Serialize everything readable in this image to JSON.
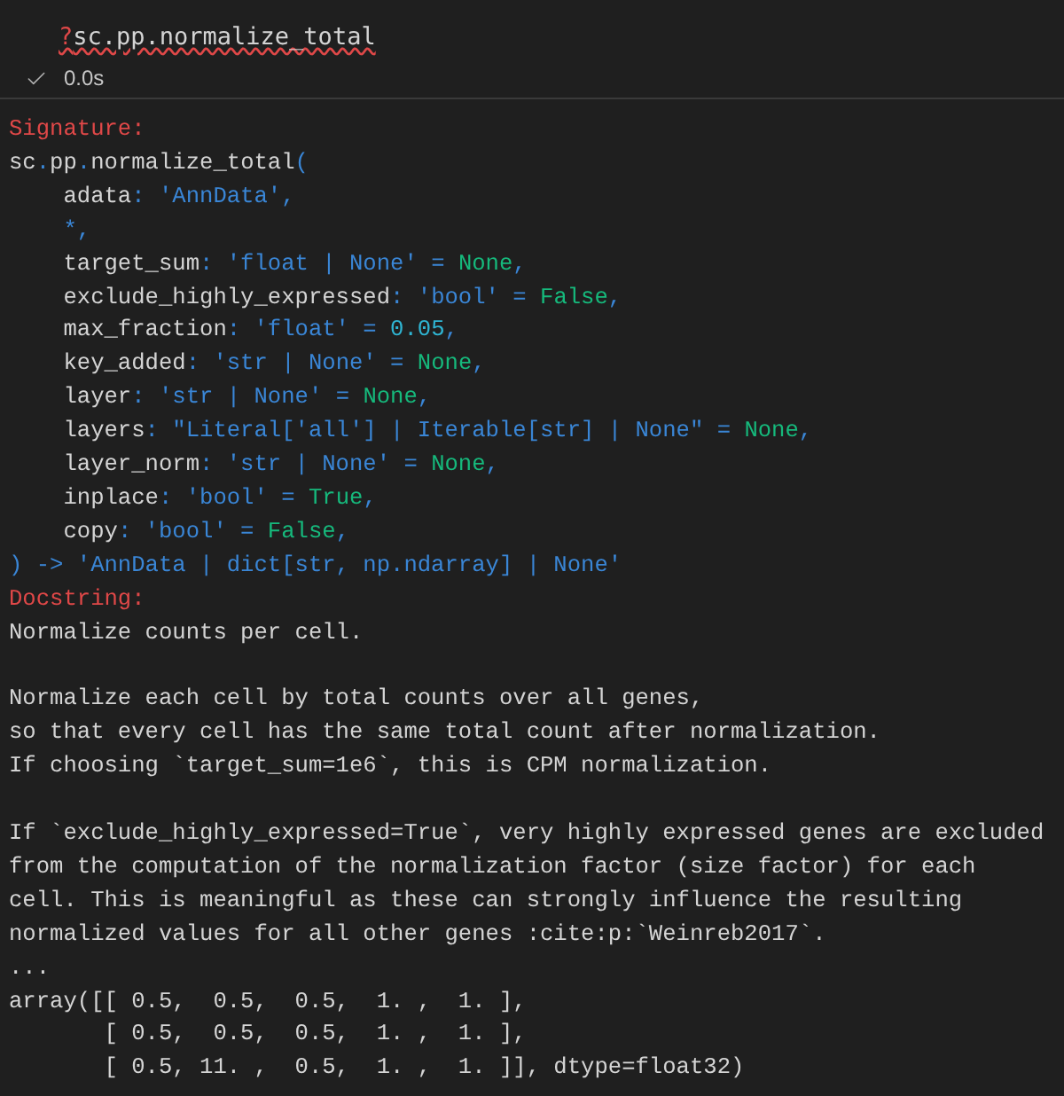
{
  "input_cell": {
    "prompt_char": "?",
    "code": "sc.pp.normalize_total",
    "has_error": true
  },
  "status": {
    "succeeded": true,
    "duration": "0.0s"
  },
  "output": [
    {
      "kind": "line",
      "tokens": [
        {
          "kind": "heading",
          "text": "Signature:"
        }
      ]
    },
    {
      "kind": "line",
      "tokens": [
        {
          "kind": "plain",
          "text": "sc"
        },
        {
          "kind": "type",
          "text": "."
        },
        {
          "kind": "plain",
          "text": "pp"
        },
        {
          "kind": "type",
          "text": "."
        },
        {
          "kind": "plain",
          "text": "normalize_total"
        },
        {
          "kind": "type",
          "text": "("
        }
      ]
    },
    {
      "kind": "line",
      "tokens": [
        {
          "kind": "plain",
          "text": "    adata"
        },
        {
          "kind": "type",
          "text": ": 'AnnData',"
        }
      ]
    },
    {
      "kind": "line",
      "tokens": [
        {
          "kind": "type",
          "text": "    *,"
        }
      ]
    },
    {
      "kind": "line",
      "tokens": [
        {
          "kind": "plain",
          "text": "    target_sum"
        },
        {
          "kind": "type",
          "text": ": 'float | None' = "
        },
        {
          "kind": "constant",
          "text": "None"
        },
        {
          "kind": "type",
          "text": ","
        }
      ]
    },
    {
      "kind": "line",
      "tokens": [
        {
          "kind": "plain",
          "text": "    exclude_highly_expressed"
        },
        {
          "kind": "type",
          "text": ": 'bool' = "
        },
        {
          "kind": "constant",
          "text": "False"
        },
        {
          "kind": "type",
          "text": ","
        }
      ]
    },
    {
      "kind": "line",
      "tokens": [
        {
          "kind": "plain",
          "text": "    max_fraction"
        },
        {
          "kind": "type",
          "text": ": 'float' = "
        },
        {
          "kind": "number",
          "text": "0.05"
        },
        {
          "kind": "type",
          "text": ","
        }
      ]
    },
    {
      "kind": "line",
      "tokens": [
        {
          "kind": "plain",
          "text": "    key_added"
        },
        {
          "kind": "type",
          "text": ": 'str | None' = "
        },
        {
          "kind": "constant",
          "text": "None"
        },
        {
          "kind": "type",
          "text": ","
        }
      ]
    },
    {
      "kind": "line",
      "tokens": [
        {
          "kind": "plain",
          "text": "    layer"
        },
        {
          "kind": "type",
          "text": ": 'str | None' = "
        },
        {
          "kind": "constant",
          "text": "None"
        },
        {
          "kind": "type",
          "text": ","
        }
      ]
    },
    {
      "kind": "line",
      "tokens": [
        {
          "kind": "plain",
          "text": "    layers"
        },
        {
          "kind": "type",
          "text": ": \"Literal['all'] | Iterable[str] | None\" = "
        },
        {
          "kind": "constant",
          "text": "None"
        },
        {
          "kind": "type",
          "text": ","
        }
      ]
    },
    {
      "kind": "line",
      "tokens": [
        {
          "kind": "plain",
          "text": "    layer_norm"
        },
        {
          "kind": "type",
          "text": ": 'str | None' = "
        },
        {
          "kind": "constant",
          "text": "None"
        },
        {
          "kind": "type",
          "text": ","
        }
      ]
    },
    {
      "kind": "line",
      "tokens": [
        {
          "kind": "plain",
          "text": "    inplace"
        },
        {
          "kind": "type",
          "text": ": 'bool' = "
        },
        {
          "kind": "constant",
          "text": "True"
        },
        {
          "kind": "type",
          "text": ","
        }
      ]
    },
    {
      "kind": "line",
      "tokens": [
        {
          "kind": "plain",
          "text": "    copy"
        },
        {
          "kind": "type",
          "text": ": 'bool' = "
        },
        {
          "kind": "constant",
          "text": "False"
        },
        {
          "kind": "type",
          "text": ","
        }
      ]
    },
    {
      "kind": "line",
      "tokens": [
        {
          "kind": "type",
          "text": ") -> 'AnnData | dict[str, np.ndarray] | None'"
        }
      ]
    },
    {
      "kind": "line",
      "tokens": [
        {
          "kind": "heading",
          "text": "Docstring:"
        }
      ]
    },
    {
      "kind": "line",
      "tokens": [
        {
          "kind": "plain",
          "text": "Normalize counts per cell."
        }
      ]
    },
    {
      "kind": "blank"
    },
    {
      "kind": "line",
      "tokens": [
        {
          "kind": "plain",
          "text": "Normalize each cell by total counts over all genes,"
        }
      ]
    },
    {
      "kind": "line",
      "tokens": [
        {
          "kind": "plain",
          "text": "so that every cell has the same total count after normalization."
        }
      ]
    },
    {
      "kind": "line",
      "tokens": [
        {
          "kind": "plain",
          "text": "If choosing `target_sum=1e6`, this is CPM normalization."
        }
      ]
    },
    {
      "kind": "blank"
    },
    {
      "kind": "line",
      "tokens": [
        {
          "kind": "plain",
          "text": "If `exclude_highly_expressed=True`, very highly expressed genes are excluded"
        }
      ]
    },
    {
      "kind": "line",
      "tokens": [
        {
          "kind": "plain",
          "text": "from the computation of the normalization factor (size factor) for each"
        }
      ]
    },
    {
      "kind": "line",
      "tokens": [
        {
          "kind": "plain",
          "text": "cell. This is meaningful as these can strongly influence the resulting"
        }
      ]
    },
    {
      "kind": "line",
      "tokens": [
        {
          "kind": "plain",
          "text": "normalized values for all other genes :cite:p:`Weinreb2017`."
        }
      ]
    },
    {
      "kind": "line",
      "tokens": [
        {
          "kind": "plain",
          "text": "..."
        }
      ]
    },
    {
      "kind": "line",
      "tokens": [
        {
          "kind": "plain",
          "text": "array([[ 0.5,  0.5,  0.5,  1. ,  1. ],"
        }
      ]
    },
    {
      "kind": "line",
      "tokens": [
        {
          "kind": "plain",
          "text": "       [ 0.5,  0.5,  0.5,  1. ,  1. ],"
        }
      ]
    },
    {
      "kind": "line",
      "tokens": [
        {
          "kind": "plain",
          "text": "       [ 0.5, 11. ,  0.5,  1. ,  1. ]], dtype=float32)"
        }
      ]
    }
  ]
}
